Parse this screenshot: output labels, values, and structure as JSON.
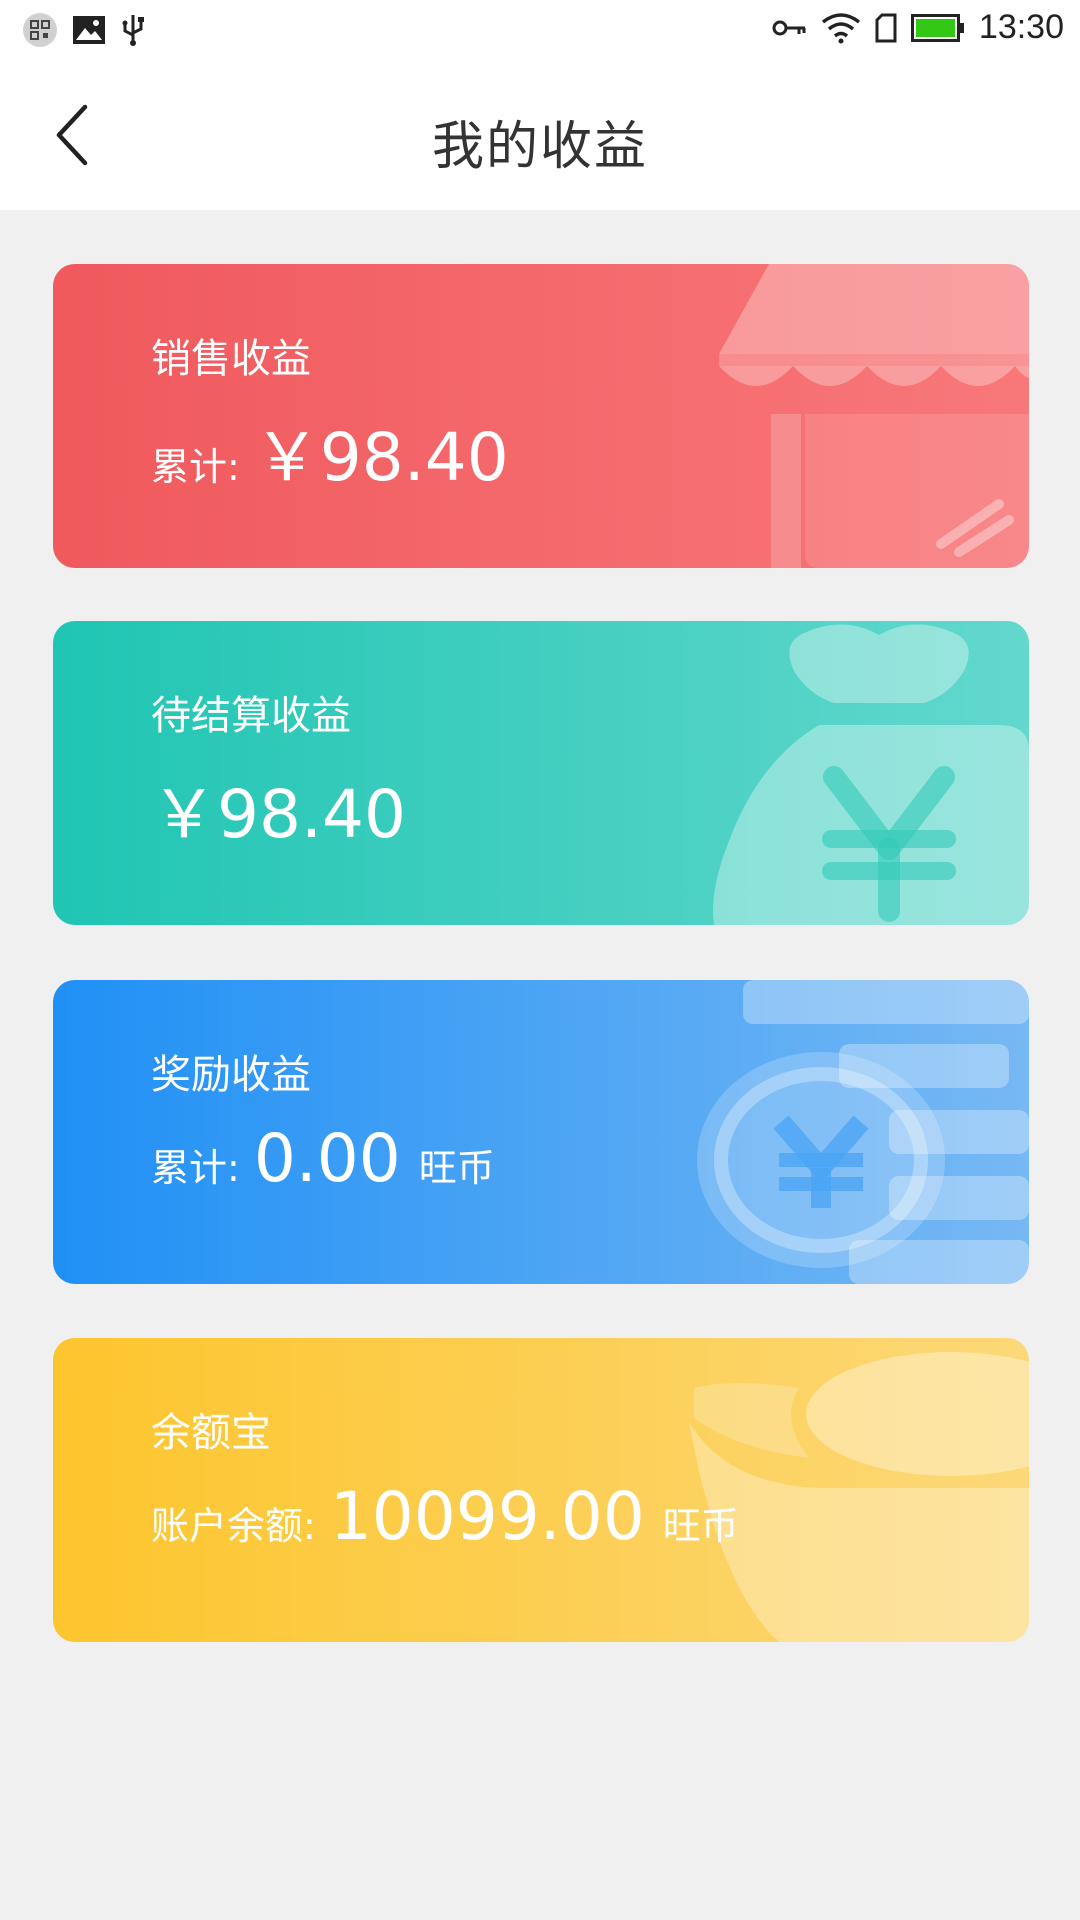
{
  "status_bar": {
    "time": "13:30",
    "left_icons": [
      "qr-icon",
      "image-icon",
      "usb-icon"
    ],
    "right_icons": [
      "key-icon",
      "wifi-icon",
      "sim-icon",
      "battery-icon"
    ],
    "battery_level": 1.0
  },
  "header": {
    "title": "我的收益",
    "back_icon": "chevron-left-icon"
  },
  "cards": [
    {
      "label": "销售收益",
      "prefix": "累计:",
      "amount": "￥98.40",
      "unit": "",
      "color_start": "#f0595d",
      "color_end": "#f8787a",
      "deco_icon": "storefront-icon"
    },
    {
      "label": "待结算收益",
      "prefix": "",
      "amount": "￥98.40",
      "unit": "",
      "color_start": "#20c5b3",
      "color_end": "#63d8cd",
      "deco_icon": "money-bag-icon"
    },
    {
      "label": "奖励收益",
      "prefix": "累计:",
      "amount": "0.00",
      "unit": "旺币",
      "color_start": "#2090f5",
      "color_end": "#76b8f4",
      "deco_icon": "coin-stack-icon"
    },
    {
      "label": "余额宝",
      "prefix": "账户余额:",
      "amount": "10099.00",
      "unit": "旺币",
      "color_start": "#fdc52d",
      "color_end": "#fcd878",
      "deco_icon": "gold-ingot-icon"
    }
  ]
}
